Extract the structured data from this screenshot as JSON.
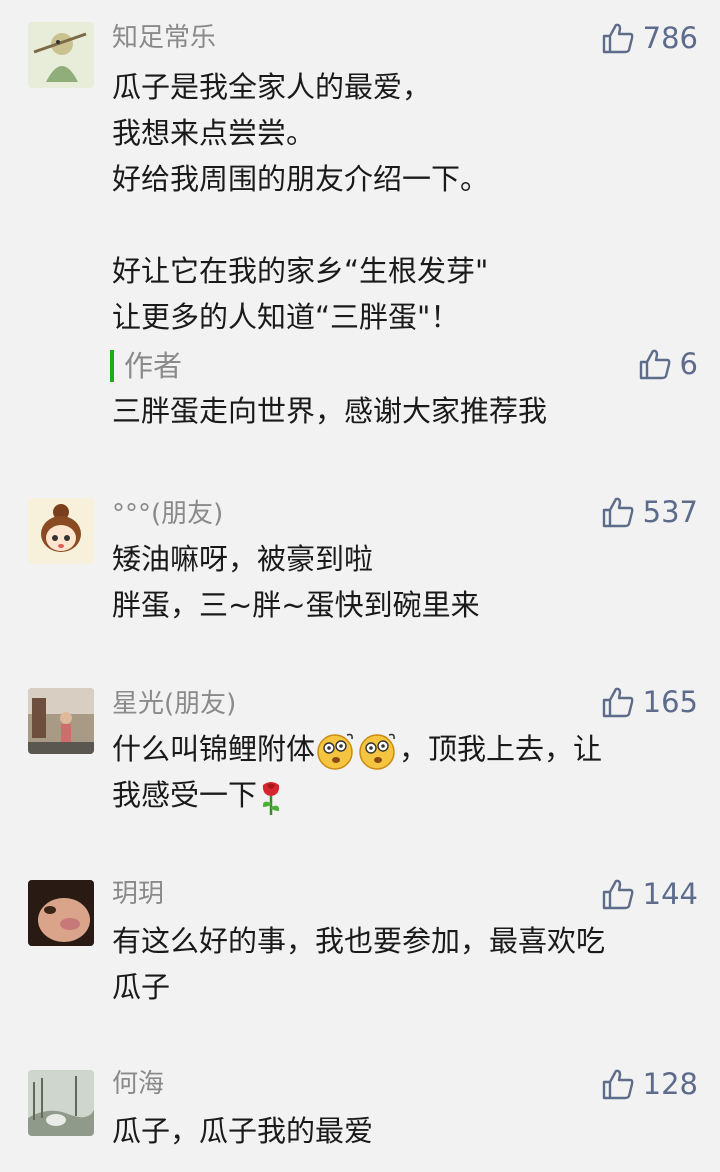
{
  "comments": [
    {
      "author": "知足常乐",
      "likes": "786",
      "text": "瓜子是我全家人的最爱，\n我想来点尝尝。\n好给我周围的朋友介绍一下。\n\n好让它在我的家乡“生根发芽\"\n让更多的人知道“三胖蛋\"！",
      "reply": {
        "author": "作者",
        "likes": "6",
        "text": "三胖蛋走向世界，感谢大家推荐我"
      }
    },
    {
      "author": "°°°(朋友)",
      "likes": "537",
      "text": "矮油嘛呀，被豪到啦\n胖蛋，三~胖~蛋快到碗里来"
    },
    {
      "author": "星光(朋友)",
      "likes": "165",
      "text_a": "什么叫锦鲤附体",
      "text_b": "，顶我上去，让",
      "text_c": "我感受一下"
    },
    {
      "author": "玥玥",
      "likes": "144",
      "text": "有这么好的事，我也要参加，最喜欢吃\n瓜子"
    },
    {
      "author": "何海",
      "likes": "128",
      "text": "瓜子，瓜子我的最爱"
    }
  ],
  "icons": {
    "like": "thumbs-up-icon"
  },
  "colors": {
    "author_bar": "#1aad19",
    "like": "#5d6c8a"
  }
}
